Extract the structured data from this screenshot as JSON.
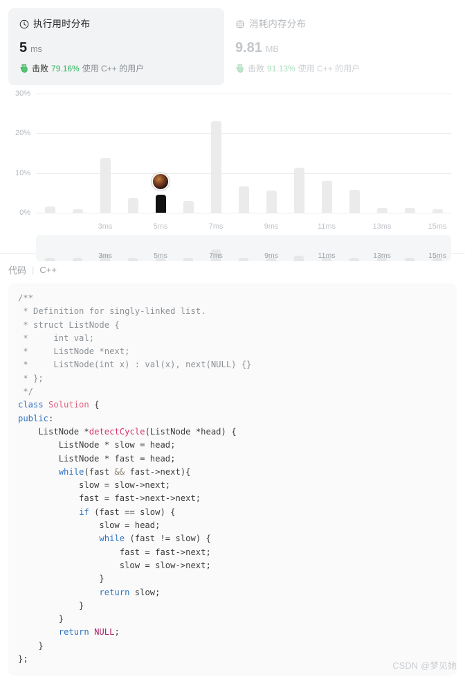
{
  "stats": {
    "runtime_card": {
      "icon": "clock-icon",
      "title": "执行用时分布",
      "value": "5",
      "unit": "ms",
      "beat_icon": "clapping-hands-icon",
      "beat_label": "击败",
      "beat_percent": "79.16%",
      "beat_tail": "使用 C++ 的用户",
      "accent_color": "#2db55d",
      "card_bg": "#f2f3f4"
    },
    "memory_card": {
      "icon": "memory-chip-icon",
      "title": "消耗内存分布",
      "value": "9.81",
      "unit": "MB",
      "beat_icon": "clapping-hands-icon",
      "beat_label": "击败",
      "beat_percent": "91.13%",
      "beat_tail": "使用 C++ 的用户",
      "accent_color": "#a8ddb9",
      "card_bg": "transparent"
    }
  },
  "chart_data": {
    "type": "bar",
    "title": "执行用时分布",
    "xlabel": "",
    "ylabel": "",
    "ylim": [
      0,
      30
    ],
    "grid": true,
    "legend": false,
    "ytick_labels": [
      "0%",
      "10%",
      "20%",
      "30%"
    ],
    "ytick_values": [
      0,
      10,
      20,
      30
    ],
    "xtick_labels": [
      "3ms",
      "5ms",
      "7ms",
      "9ms",
      "11ms",
      "13ms",
      "15ms"
    ],
    "xtick_values": [
      3,
      5,
      7,
      9,
      11,
      13,
      15
    ],
    "categories": [
      "1ms",
      "2ms",
      "3ms",
      "4ms",
      "5ms",
      "6ms",
      "7ms",
      "8ms",
      "9ms",
      "10ms",
      "11ms",
      "12ms",
      "13ms",
      "14ms",
      "15ms"
    ],
    "values": [
      1.5,
      0.8,
      13.8,
      3.7,
      4.5,
      3.0,
      23.0,
      6.7,
      5.5,
      11.3,
      8.0,
      5.8,
      1.3,
      1.3,
      0.8
    ],
    "highlight_index": 4,
    "highlight_label": "5ms",
    "highlight_color": "#111111",
    "bar_color": "#ebebeb",
    "marker": {
      "name": "user-avatar-marker",
      "category": "5ms"
    },
    "brush": {
      "values": [
        1.5,
        0.8,
        13.8,
        3.7,
        4.5,
        3.0,
        23.0,
        6.7,
        5.5,
        11.3,
        8.0,
        5.8,
        1.3,
        1.3,
        0.8
      ],
      "labels": [
        "3ms",
        "5ms",
        "7ms",
        "9ms",
        "11ms",
        "13ms",
        "15ms"
      ]
    }
  },
  "code_section": {
    "label": "代码",
    "separator": "|",
    "language": "C++",
    "lines": [
      "/**",
      " * Definition for singly-linked list.",
      " * struct ListNode {",
      " *     int val;",
      " *     ListNode *next;",
      " *     ListNode(int x) : val(x), next(NULL) {}",
      " * };",
      " */",
      "class Solution {",
      "public:",
      "    ListNode *detectCycle(ListNode *head) {",
      "        ListNode * slow = head;",
      "        ListNode * fast = head;",
      "        while(fast && fast->next){",
      "            slow = slow->next;",
      "            fast = fast->next->next;",
      "            if (fast == slow) {",
      "                slow = head;",
      "                while (fast != slow) {",
      "                    fast = fast->next;",
      "                    slow = slow->next;",
      "                }",
      "                return slow;",
      "            }",
      "        }",
      "        return NULL;",
      "    }",
      "};"
    ]
  },
  "watermark": "CSDN @梦见她"
}
